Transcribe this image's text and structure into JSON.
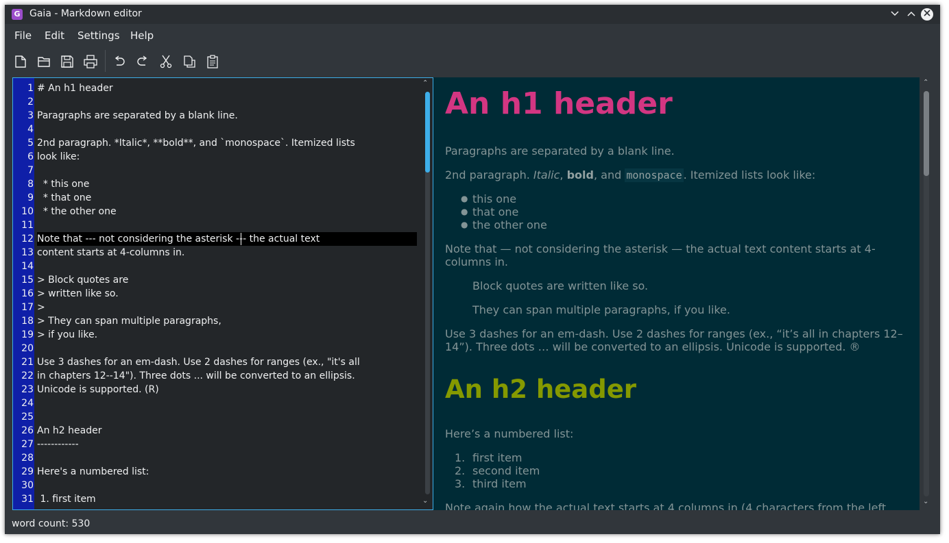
{
  "window": {
    "icon_letter": "G",
    "title": "Gaia - Markdown editor"
  },
  "menu": [
    "File",
    "Edit",
    "Settings",
    "Help"
  ],
  "toolbar": [
    "new-file-icon",
    "open-folder-icon",
    "save-icon",
    "print-icon",
    "undo-icon",
    "redo-icon",
    "cut-icon",
    "copy-icon",
    "paste-icon"
  ],
  "editor": {
    "lines": [
      {
        "n": "1",
        "t": "# An h1 header"
      },
      {
        "n": "2",
        "t": ""
      },
      {
        "n": "3",
        "t": "Paragraphs are separated by a blank line."
      },
      {
        "n": "4",
        "t": ""
      },
      {
        "n": "5",
        "t": "2nd paragraph. *Italic*, **bold**, and `monospace`. Itemized lists"
      },
      {
        "n": "6",
        "t": "look like:"
      },
      {
        "n": "7",
        "t": ""
      },
      {
        "n": "8",
        "t": "  * this one"
      },
      {
        "n": "9",
        "t": "  * that one"
      },
      {
        "n": "10",
        "t": "  * the other one"
      },
      {
        "n": "11",
        "t": ""
      },
      {
        "n": "12",
        "t": "Note that --- not considering the asterisk --- the actual text"
      },
      {
        "n": "13",
        "t": "content starts at 4-columns in."
      },
      {
        "n": "14",
        "t": ""
      },
      {
        "n": "15",
        "t": "> Block quotes are"
      },
      {
        "n": "16",
        "t": "> written like so."
      },
      {
        "n": "17",
        "t": ">"
      },
      {
        "n": "18",
        "t": "> They can span multiple paragraphs,"
      },
      {
        "n": "19",
        "t": "> if you like."
      },
      {
        "n": "20",
        "t": ""
      },
      {
        "n": "21",
        "t": "Use 3 dashes for an em-dash. Use 2 dashes for ranges (ex., \"it's all"
      },
      {
        "n": "22",
        "t": "in chapters 12--14\"). Three dots ... will be converted to an ellipsis."
      },
      {
        "n": "23",
        "t": "Unicode is supported. (R)"
      },
      {
        "n": "24",
        "t": ""
      },
      {
        "n": "25",
        "t": ""
      },
      {
        "n": "26",
        "t": "An h2 header"
      },
      {
        "n": "27",
        "t": "------------"
      },
      {
        "n": "28",
        "t": ""
      },
      {
        "n": "29",
        "t": "Here's a numbered list:"
      },
      {
        "n": "30",
        "t": ""
      },
      {
        "n": "31",
        "t": " 1. first item"
      }
    ],
    "current_line": 12
  },
  "preview": {
    "h1": "An h1 header",
    "p1": "Paragraphs are separated by a blank line.",
    "p2": {
      "a": "2nd paragraph. ",
      "italic": "Italic",
      "b": ", ",
      "bold": "bold",
      "c": ", and ",
      "mono": "monospace",
      "d": ". Itemized lists look like:"
    },
    "bullets": [
      "this one",
      "that one",
      "the other one"
    ],
    "note": [
      "Note that — not considering the asterisk — the actual text content starts at 4-",
      "columns in."
    ],
    "quote1": "Block quotes are written like so.",
    "quote2": "They can span multiple paragraphs, if you like.",
    "dashes": [
      "Use 3 dashes for an em-dash. Use 2 dashes for ranges (ex., “it’s all in chapters 12–",
      "14”). Three dots … will be converted to an ellipsis. Unicode is supported. ®"
    ],
    "h2": "An h2 header",
    "numbered_intro": "Here’s a numbered list:",
    "numbered": [
      {
        "n": "1.",
        "t": "first item"
      },
      {
        "n": "2.",
        "t": "second item"
      },
      {
        "n": "3.",
        "t": "third item"
      }
    ],
    "note_again": "Note again how the actual text starts at 4 columns in (4 characters from the left"
  },
  "status": {
    "word_count": "word count: 530"
  }
}
